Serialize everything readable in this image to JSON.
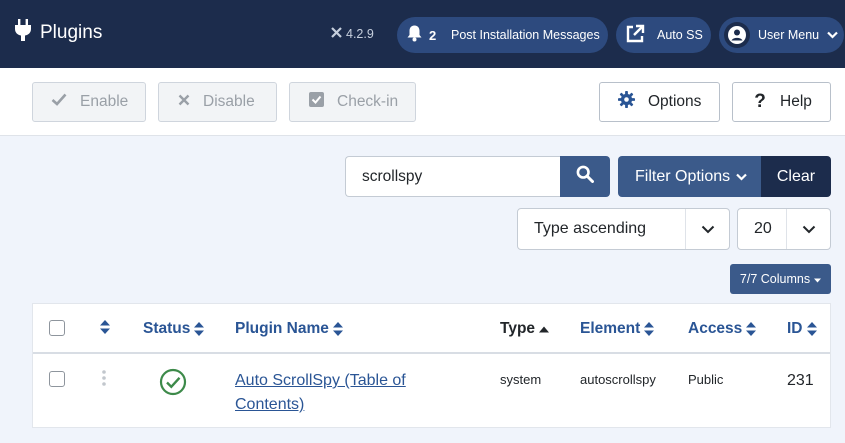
{
  "header": {
    "title": "Plugins",
    "version": "4.2.9",
    "notifications_count": "2",
    "post_install_label": "Post Installation Messages",
    "auto_ss_label": "Auto SS",
    "user_menu_label": "User Menu"
  },
  "toolbar": {
    "enable_label": "Enable",
    "disable_label": "Disable",
    "checkin_label": "Check-in",
    "options_label": "Options",
    "help_label": "Help"
  },
  "filters": {
    "search_value": "scrollspy",
    "filter_options_label": "Filter Options",
    "clear_label": "Clear",
    "sort_value": "Type ascending",
    "limit_value": "20",
    "columns_label": "7/7 Columns"
  },
  "table": {
    "columns": {
      "status": "Status",
      "plugin_name": "Plugin Name",
      "type": "Type",
      "element": "Element",
      "access": "Access",
      "id": "ID"
    },
    "rows": [
      {
        "name": "Auto ScrollSpy (Table of Contents)",
        "type": "system",
        "element": "autoscrollspy",
        "access": "Public",
        "id": "231",
        "status": "enabled"
      }
    ]
  },
  "colors": {
    "header_bg": "#1c2c4c",
    "primary": "#3b5a8a",
    "link": "#2a5595",
    "status_green": "#3d8a4a"
  }
}
